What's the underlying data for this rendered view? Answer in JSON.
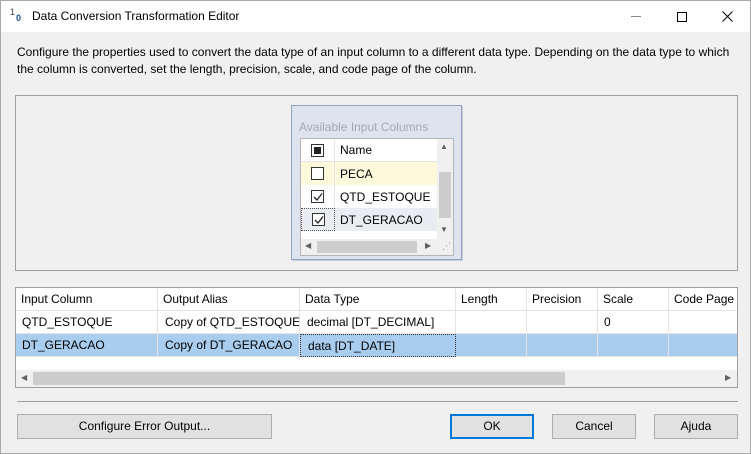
{
  "window": {
    "title": "Data Conversion Transformation Editor"
  },
  "description": "Configure the properties used to convert the data type of an input column to a different data type. Depending on the data type to which the column is converted, set the length, precision, scale, and code page of the column.",
  "available_columns": {
    "title": "Available Input Columns",
    "header": "Name",
    "items": [
      {
        "label": "PECA",
        "checked": false
      },
      {
        "label": "QTD_ESTOQUE",
        "checked": true
      },
      {
        "label": "DT_GERACAO",
        "checked": true
      }
    ]
  },
  "grid": {
    "headers": [
      "Input Column",
      "Output Alias",
      "Data Type",
      "Length",
      "Precision",
      "Scale",
      "Code Page"
    ],
    "rows": [
      [
        "QTD_ESTOQUE",
        "Copy of QTD_ESTOQUE",
        "decimal [DT_DECIMAL]",
        "",
        "",
        "0",
        ""
      ],
      [
        "DT_GERACAO",
        "Copy of DT_GERACAO",
        "data [DT_DATE]",
        "",
        "",
        "",
        ""
      ]
    ],
    "selected_row": 1,
    "selection_color": "#a9cdef"
  },
  "buttons": {
    "configure_error_output": "Configure Error Output...",
    "ok": "OK",
    "cancel": "Cancel",
    "help": "Ajuda"
  },
  "icons": {
    "app": "data-conversion-icon",
    "minimize": "minimize-icon",
    "maximize": "maximize-icon",
    "close": "close-icon"
  }
}
